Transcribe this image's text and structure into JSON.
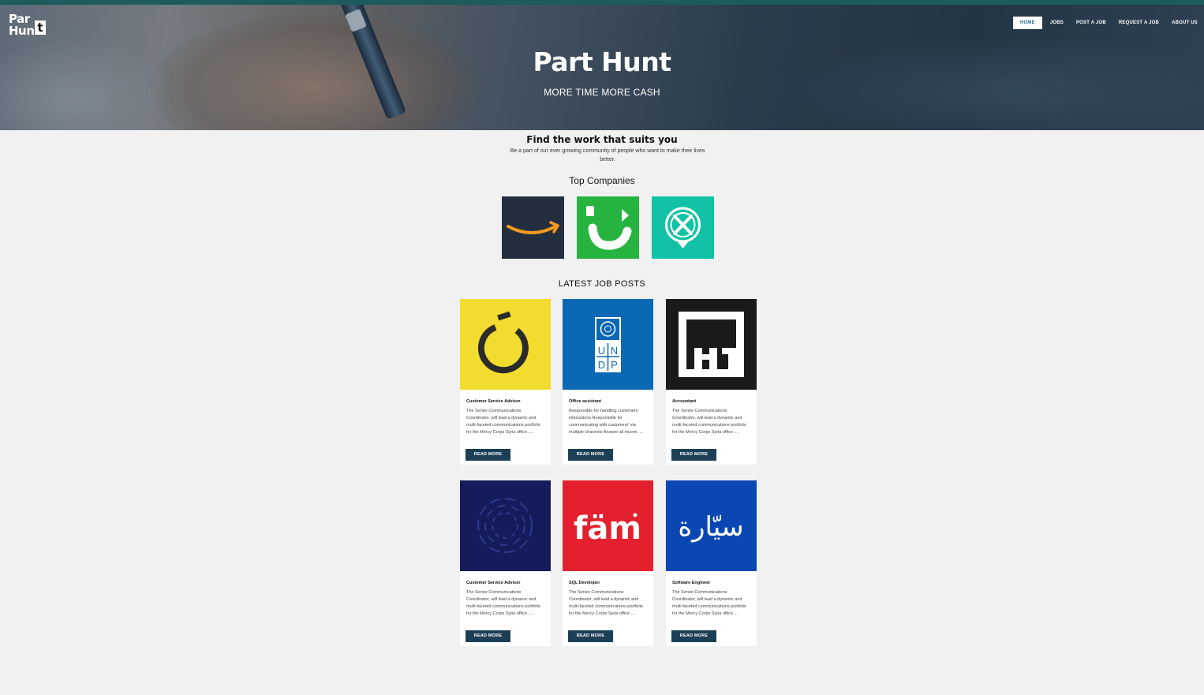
{
  "site": {
    "logo_line1": "Par",
    "logo_line2": "Hun",
    "logo_t": "t"
  },
  "nav": {
    "items": [
      {
        "label": "HOME",
        "active": true
      },
      {
        "label": "JOBS"
      },
      {
        "label": "POST A JOB"
      },
      {
        "label": "REQUEST A JOB"
      },
      {
        "label": "ABOUT US"
      }
    ]
  },
  "hero": {
    "title": "Part Hunt",
    "subtitle": "MORE TIME MORE CASH"
  },
  "intro": {
    "title": "Find the work that suits you",
    "text": "Be a part of our ever growing community of people who want to make their lives better."
  },
  "companies": {
    "heading": "Top Companies",
    "items": [
      {
        "name": "amazon",
        "icon": "amazon-logo",
        "color": "#232f3e"
      },
      {
        "name": "careem",
        "icon": "careem-logo",
        "color": "#27b33f"
      },
      {
        "name": "company-3",
        "icon": "pin-logo",
        "color": "#12c2a6"
      }
    ]
  },
  "jobs": {
    "heading": "LATEST JOB POSTS",
    "read_more": "READ MORE",
    "items": [
      {
        "title": "Customer Service Advisor",
        "desc": "The Senior Communications Coordinator, will lead a dynamic and multi-faceted communications portfolio for the Mercy Corps Syria office ....",
        "logo": "noon-logo",
        "bg": "#f2dc2f"
      },
      {
        "title": "Office assistant",
        "desc": "Responsible for handling customers' interactions Responsible for communicating with customers' via multiple channels Answer all incomi ....",
        "logo": "undp-logo",
        "bg": "#0a68b4"
      },
      {
        "title": "Accountant",
        "desc": "The Senior Communications Coordinator, will lead a dynamic and multi-faceted communications portfolio for the Mercy Corps Syria office ....",
        "logo": "h1-logo",
        "bg": "#1a1a1a"
      },
      {
        "title": "Customer Service Advisor",
        "desc": "The Senior Communications Coordinator, will lead a dynamic and multi-faceted communications portfolio for the Mercy Corps Syria office ....",
        "logo": "circle-logo",
        "bg": "#161b5c"
      },
      {
        "title": "SQL Developer",
        "desc": "The Senior Communications Coordinator, will lead a dynamic and multi-faceted communications portfolio for the Mercy Corps Syria office ....",
        "logo": "fam-logo",
        "bg": "#e4202e",
        "logo_text": "fäm"
      },
      {
        "title": "Software Engineer",
        "desc": "The Senior Communications Coordinator, will lead a dynamic and multi-faceted communications portfolio for the Mercy Corps Syria office ....",
        "logo": "sayara-logo",
        "bg": "#0b47b3",
        "logo_text": "سيّارة"
      }
    ]
  }
}
